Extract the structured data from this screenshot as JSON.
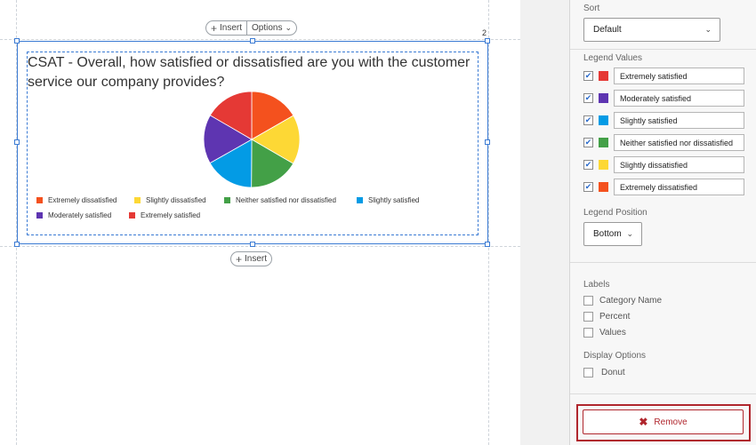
{
  "toolbar": {
    "insert_label": "Insert",
    "options_label": "Options"
  },
  "bottom_insert_label": "Insert",
  "page_number": "2",
  "widget": {
    "title": "CSAT - Overall, how satisfied or dissatisfied are you with the customer service our company provides?"
  },
  "chart_data": {
    "type": "pie",
    "title": "CSAT - Overall, how satisfied or dissatisfied are you with the customer service our company provides?",
    "labels": [
      "Extremely dissatisfied",
      "Slightly dissatisfied",
      "Neither satisfied nor dissatisfied",
      "Slightly satisfied",
      "Moderately satisfied",
      "Extremely satisfied"
    ],
    "values": [
      16.7,
      16.7,
      16.7,
      16.7,
      16.6,
      16.6
    ],
    "colors": [
      "#F4511E",
      "#FDD835",
      "#43A047",
      "#039BE5",
      "#5E35B1",
      "#E53935"
    ],
    "legend_position": "bottom"
  },
  "panel": {
    "sort": {
      "label": "Sort",
      "value": "Default"
    },
    "legend_values": {
      "label": "Legend Values",
      "items": [
        {
          "label": "Extremely satisfied",
          "color": "#E53935",
          "checked": true
        },
        {
          "label": "Moderately satisfied",
          "color": "#5E35B1",
          "checked": true
        },
        {
          "label": "Slightly satisfied",
          "color": "#039BE5",
          "checked": true
        },
        {
          "label": "Neither satisfied nor dissatisfied",
          "color": "#43A047",
          "checked": true
        },
        {
          "label": "Slightly dissatisfied",
          "color": "#FDD835",
          "checked": true
        },
        {
          "label": "Extremely dissatisfied",
          "color": "#F4511E",
          "checked": true
        }
      ]
    },
    "legend_position": {
      "label": "Legend Position",
      "value": "Bottom"
    },
    "labels": {
      "label": "Labels",
      "category_name": "Category Name",
      "percent": "Percent",
      "values": "Values"
    },
    "display_options": {
      "label": "Display Options",
      "donut": "Donut"
    },
    "remove_label": "Remove"
  },
  "icons": {
    "plus": "plus-icon",
    "chevron": "chevron-down-icon",
    "check": "check-icon",
    "close": "x-icon"
  }
}
